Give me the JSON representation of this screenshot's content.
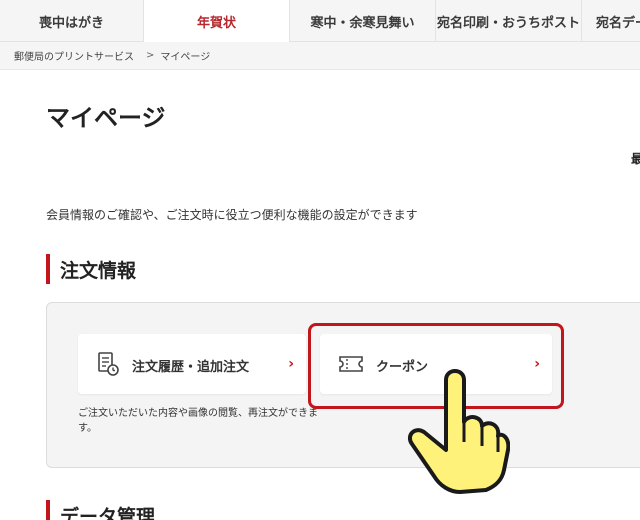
{
  "tabs": [
    {
      "label": "喪中はがき",
      "active": false
    },
    {
      "label": "年賀状",
      "active": true
    },
    {
      "label": "寒中・余寒見舞い",
      "active": false
    },
    {
      "label": "宛名印刷・おうちポスト",
      "active": false
    },
    {
      "label": "宛名デー",
      "active": false
    }
  ],
  "breadcrumb": {
    "home": "郵便局のプリントサービス",
    "separator": ">",
    "current": "マイページ"
  },
  "page": {
    "title": "マイページ",
    "cutoff_text": "最",
    "intro": "会員情報のご確認や、ご注文時に役立つ便利な機能の設定ができます"
  },
  "sections": {
    "orders": {
      "title": "注文情報"
    },
    "data": {
      "title": "データ管理"
    }
  },
  "cards": {
    "order_history": {
      "label": "注文履歴・追加注文",
      "icon": "receipt-icon",
      "chevron": "›",
      "desc_line1": "ご注文いただいた内容や画像の閲覧、再注文ができま",
      "desc_line2": "す。"
    },
    "coupon": {
      "label": "クーポン",
      "icon": "ticket-icon",
      "chevron": "›"
    }
  },
  "colors": {
    "accent": "#c3151c",
    "active_tab_text": "#b5292f",
    "panel_bg": "#f4f4f4",
    "hand_fill": "#fff27a"
  }
}
